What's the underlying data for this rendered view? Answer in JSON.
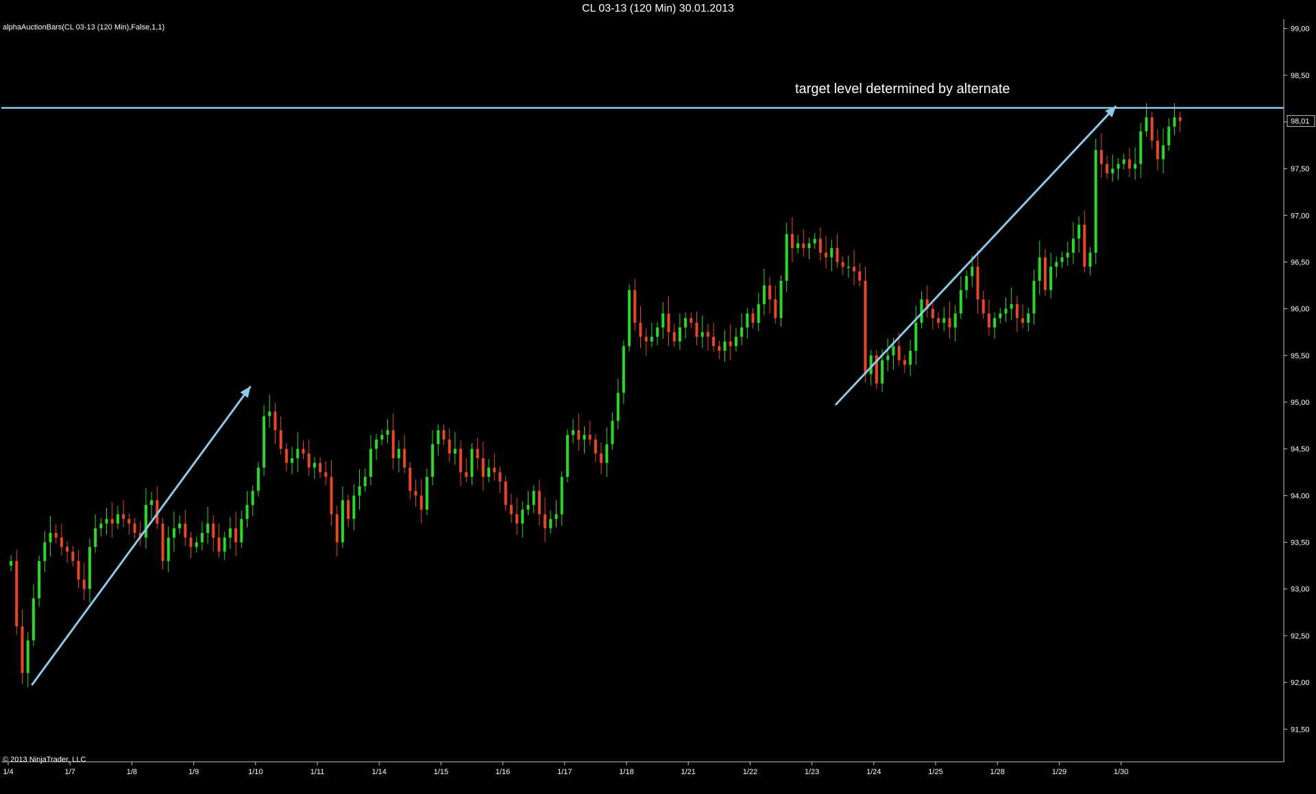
{
  "window": {
    "title": "CL 03-13 (120 Min)  30.01.2013"
  },
  "indicator_label": "alphaAuctionBars(CL 03-13 (120 Min),False,1,1)",
  "copyright": "© 2013 NinjaTrader, LLC",
  "annotation_text": "target level determined by alternate",
  "price_marker": "98,01",
  "colors": {
    "background": "#000000",
    "up": "#22dd22",
    "down": "#ee4422",
    "drawing": "#8ccbea",
    "axis": "#c8c8c8"
  },
  "chart_data": {
    "type": "candlestick",
    "title": "CL 03-13 (120 Min)  30.01.2013",
    "ylim": [
      91.15,
      99.1
    ],
    "y_ticks": [
      "91,50",
      "92,00",
      "92,50",
      "93,00",
      "93,50",
      "94,00",
      "94,50",
      "95,00",
      "95,50",
      "96,00",
      "96,50",
      "97,00",
      "97,50",
      "98,00",
      "98,50",
      "99,00"
    ],
    "x_ticks": [
      "1/4",
      "1/7",
      "1/8",
      "1/9",
      "1/10",
      "1/11",
      "1/14",
      "1/15",
      "1/16",
      "1/17",
      "1/18",
      "1/21",
      "1/22",
      "1/23",
      "1/24",
      "1/25",
      "1/28",
      "1/29",
      "1/30"
    ],
    "horizontal_line": 98.15,
    "trend_arrows": [
      {
        "from": [
          "1/4",
          91.97
        ],
        "to": [
          "1/10",
          95.17
        ]
      },
      {
        "from": [
          "1/23",
          94.97
        ],
        "to": [
          "1/30",
          98.17
        ]
      }
    ],
    "bars_per_session": 11,
    "sessions": [
      {
        "date": "1/4",
        "close": [
          93.3,
          92.6,
          92.1,
          92.45,
          92.9,
          93.3,
          93.5,
          93.6,
          93.55,
          93.45,
          93.4
        ]
      },
      {
        "date": "1/7",
        "close": [
          93.3,
          93.1,
          93.0,
          93.45,
          93.65,
          93.7,
          93.75,
          93.7,
          93.8,
          93.75,
          93.7
        ]
      },
      {
        "date": "1/8",
        "close": [
          93.6,
          93.55,
          93.9,
          93.95,
          93.7,
          93.3,
          93.55,
          93.65,
          93.7,
          93.55,
          93.45
        ]
      },
      {
        "date": "1/9",
        "close": [
          93.5,
          93.6,
          93.7,
          93.55,
          93.4,
          93.55,
          93.65,
          93.5,
          93.75,
          93.9,
          94.05
        ]
      },
      {
        "date": "1/10",
        "close": [
          94.3,
          94.85,
          94.9,
          94.7,
          94.5,
          94.35,
          94.4,
          94.5,
          94.45,
          94.3,
          94.35
        ]
      },
      {
        "date": "1/11",
        "close": [
          94.25,
          94.2,
          93.8,
          93.5,
          93.95,
          93.75,
          94.0,
          94.1,
          94.2,
          94.5,
          94.6
        ]
      },
      {
        "date": "1/14",
        "close": [
          94.65,
          94.7,
          94.4,
          94.5,
          94.3,
          94.05,
          94.0,
          93.85,
          94.2,
          94.55,
          94.7
        ]
      },
      {
        "date": "1/15",
        "close": [
          94.6,
          94.45,
          94.5,
          94.25,
          94.2,
          94.5,
          94.4,
          94.2,
          94.3,
          94.25,
          94.15
        ]
      },
      {
        "date": "1/16",
        "close": [
          93.9,
          93.8,
          93.7,
          93.85,
          93.9,
          94.05,
          93.8,
          93.65,
          93.75,
          93.8,
          94.2
        ]
      },
      {
        "date": "1/17",
        "close": [
          94.65,
          94.7,
          94.6,
          94.65,
          94.6,
          94.45,
          94.35,
          94.55,
          94.8,
          95.1,
          95.6
        ]
      },
      {
        "date": "1/18",
        "close": [
          96.2,
          95.85,
          95.7,
          95.65,
          95.7,
          95.8,
          95.95,
          95.75,
          95.65,
          95.8,
          95.9
        ]
      },
      {
        "date": "1/21",
        "close": [
          95.85,
          95.7,
          95.75,
          95.7,
          95.6,
          95.55,
          95.65,
          95.6,
          95.7,
          95.8,
          95.95
        ]
      },
      {
        "date": "1/22",
        "close": [
          95.85,
          96.05,
          96.25,
          96.1,
          95.9,
          96.3,
          96.8,
          96.65,
          96.7,
          96.65,
          96.7
        ]
      },
      {
        "date": "1/23",
        "close": [
          96.75,
          96.6,
          96.55,
          96.65,
          96.5,
          96.45,
          96.45,
          96.4,
          96.3,
          95.3,
          95.5
        ]
      },
      {
        "date": "1/24",
        "close": [
          95.2,
          95.45,
          95.5,
          95.6,
          95.45,
          95.4,
          95.55,
          95.85,
          96.1,
          96.0,
          95.9
        ]
      },
      {
        "date": "1/25",
        "close": [
          95.85,
          95.9,
          95.8,
          95.95,
          96.2,
          96.35,
          96.45,
          96.1,
          95.95,
          95.8,
          95.9
        ]
      },
      {
        "date": "1/28",
        "close": [
          95.95,
          96.0,
          96.05,
          95.9,
          95.85,
          95.95,
          96.3,
          96.55,
          96.2,
          96.45,
          96.5
        ]
      },
      {
        "date": "1/29",
        "close": [
          96.55,
          96.6,
          96.75,
          96.9,
          96.45,
          96.6,
          97.7,
          97.55,
          97.45,
          97.5,
          97.55
        ]
      },
      {
        "date": "1/30",
        "close": [
          97.6,
          97.5,
          97.55,
          97.9,
          98.05,
          97.8,
          97.6,
          97.75,
          97.95,
          98.05,
          98.01
        ]
      }
    ]
  }
}
